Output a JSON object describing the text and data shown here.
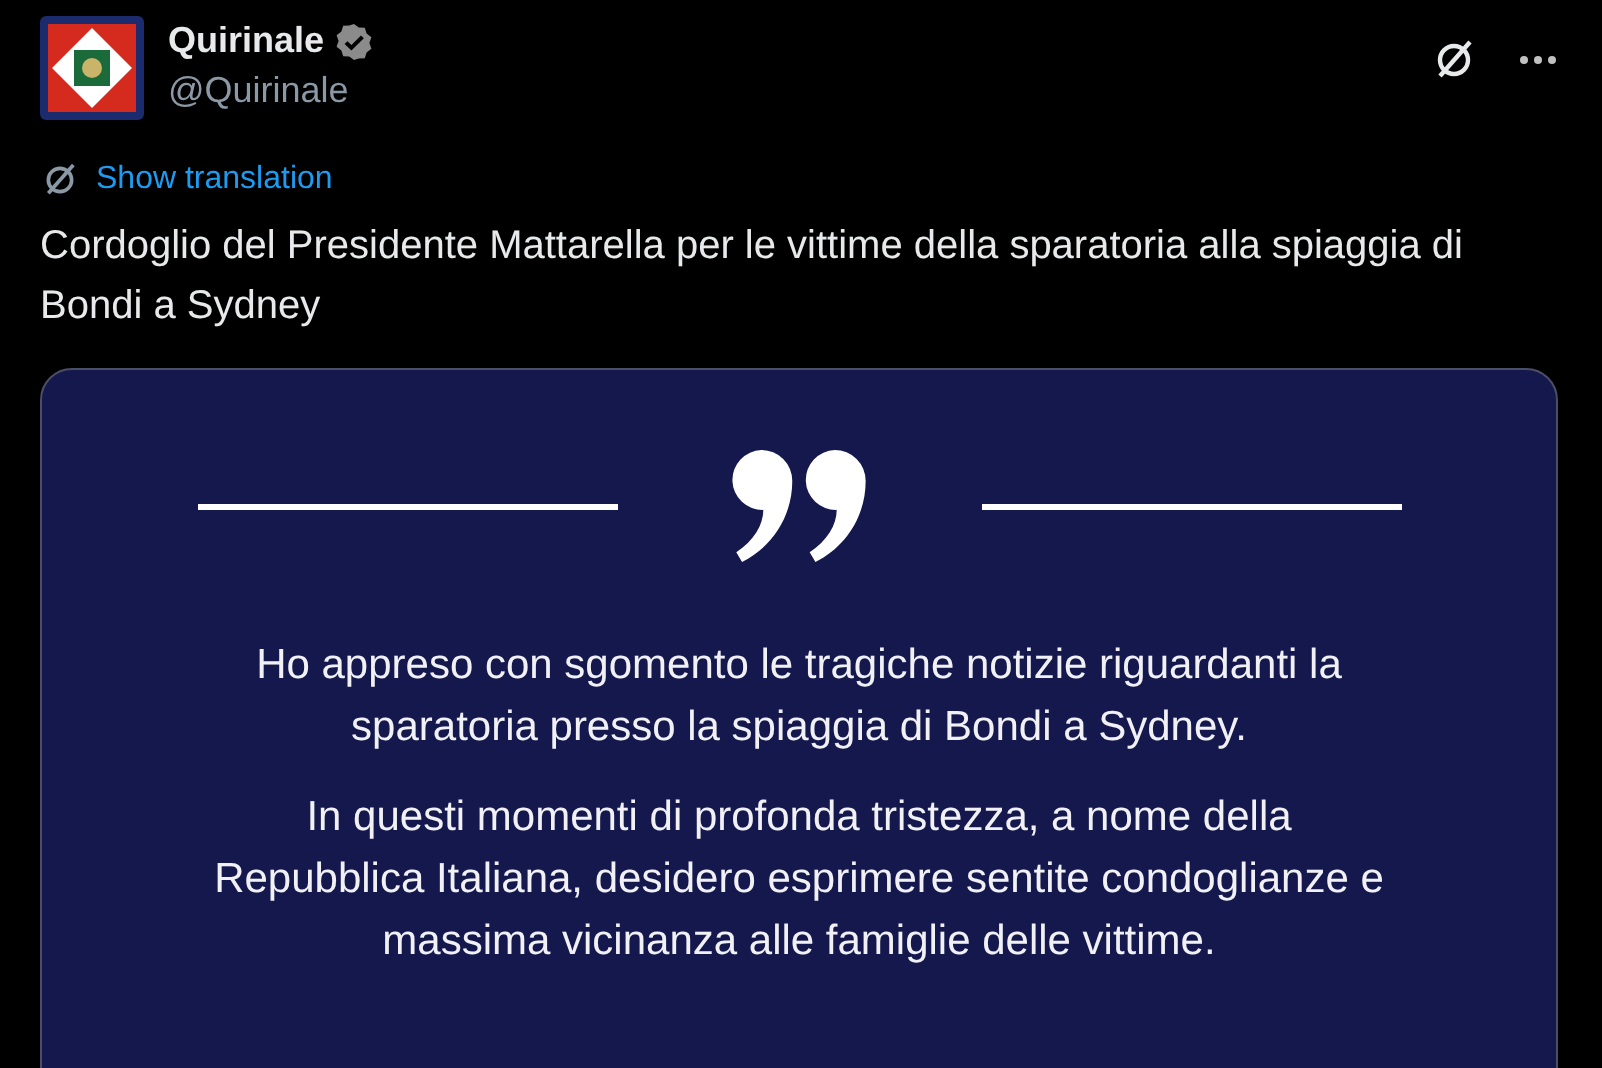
{
  "author": {
    "name": "Quirinale",
    "handle": "@Quirinale",
    "verified": true
  },
  "translate_link": "Show translation",
  "tweet_text": "Cordoglio del Presidente Mattarella per le vittime della sparatoria alla spiaggia di Bondi a Sydney",
  "quote_card": {
    "paragraphs": [
      "Ho appreso con sgomento le tragiche notizie riguardanti la sparatoria presso la spiaggia di Bondi a Sydney.",
      "In questi momenti di profonda tristezza, a nome della Repubblica Italiana, desidero esprimere sentite condoglianze e massima vicinanza alle famiglie delle vittime."
    ]
  }
}
